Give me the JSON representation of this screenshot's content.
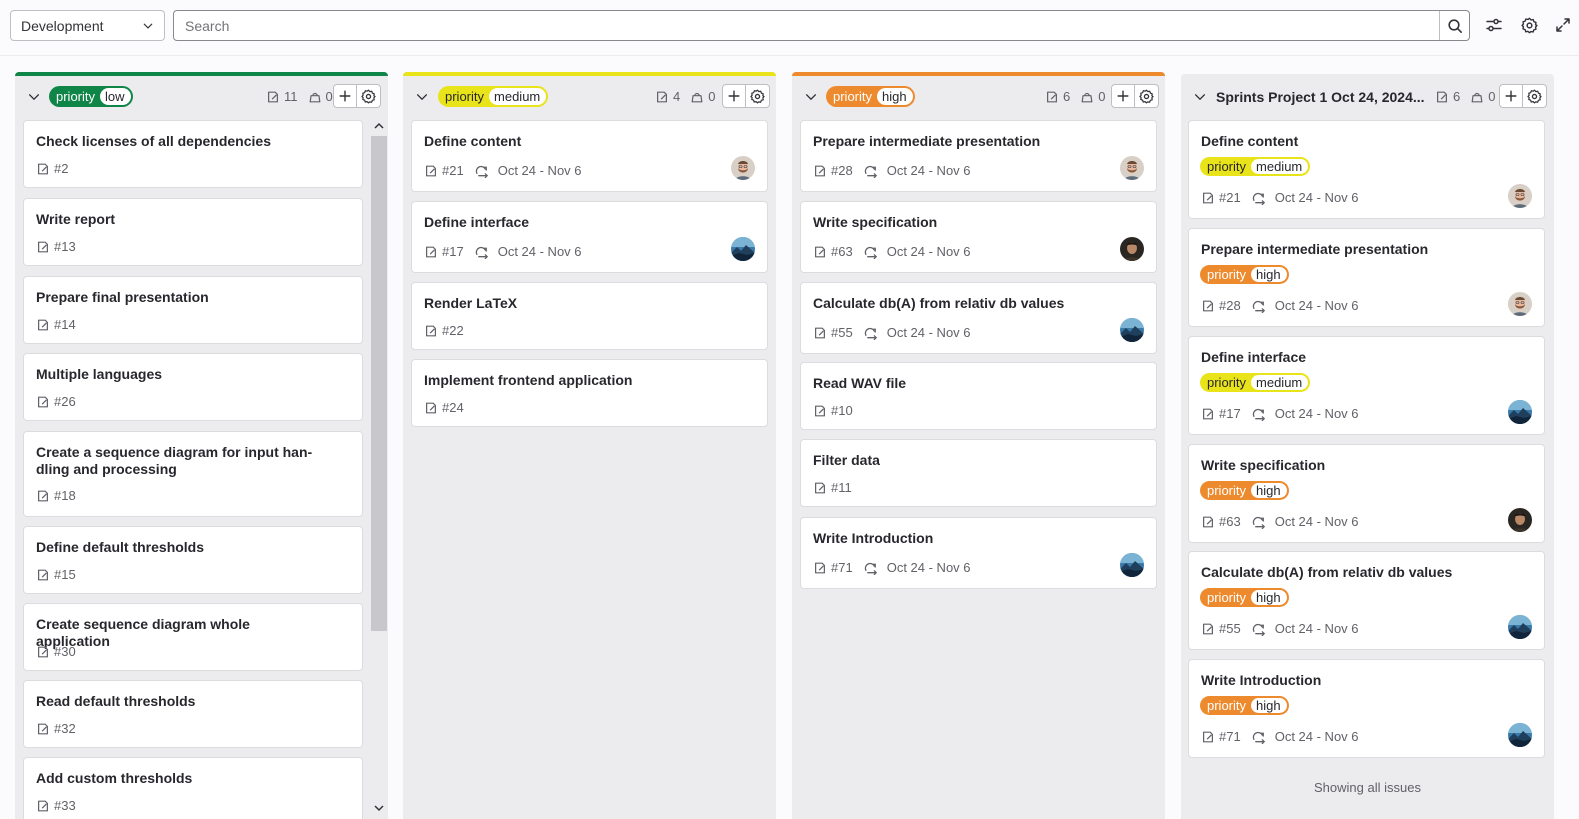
{
  "toolbar": {
    "board_select": "Development",
    "search_placeholder": "Search"
  },
  "colors": {
    "low": "#108548",
    "medium": "#e9e319",
    "high": "#ee8a2e",
    "sprint_bar": "#e4e4e8"
  },
  "lists": [
    {
      "label_key": "priority",
      "label_value": "low",
      "issues_count": "11",
      "weight": "0",
      "cards": [
        {
          "title": "Check licenses of all dependencies",
          "num": "#2"
        },
        {
          "title": "Write report",
          "num": "#13"
        },
        {
          "title": "Prepare final presentation",
          "num": "#14"
        },
        {
          "title": "Multiple languages",
          "num": "#26"
        },
        {
          "title": "Create a sequence diagram for input han-dling and processing",
          "title_line1": "Create a sequence diagram for input han-",
          "title_line2": "dling and processing",
          "num": "#18"
        },
        {
          "title": "Define default thresholds",
          "num": "#15"
        },
        {
          "title": "Create sequence diagram whole application",
          "num": "#30"
        },
        {
          "title": "Read default thresholds",
          "num": "#32"
        },
        {
          "title": "Add custom thresholds",
          "num": "#33"
        }
      ]
    },
    {
      "label_key": "priority",
      "label_value": "medium",
      "issues_count": "4",
      "weight": "0",
      "cards": [
        {
          "title": "Define content",
          "num": "#21",
          "dates": "Oct 24 - Nov 6",
          "avatar": "bearded-man-avatar"
        },
        {
          "title": "Define interface",
          "num": "#17",
          "dates": "Oct 24 - Nov 6",
          "avatar": "mountain-avatar"
        },
        {
          "title": "Render LaTeX",
          "num": "#22"
        },
        {
          "title": "Implement frontend application",
          "num": "#24"
        }
      ]
    },
    {
      "label_key": "priority",
      "label_value": "high",
      "issues_count": "6",
      "weight": "0",
      "cards": [
        {
          "title": "Prepare intermediate presentation",
          "num": "#28",
          "dates": "Oct 24 - Nov 6",
          "avatar": "bearded-man-avatar"
        },
        {
          "title": "Write specification",
          "num": "#63",
          "dates": "Oct 24 - Nov 6",
          "avatar": "dark-portrait-avatar"
        },
        {
          "title": "Calculate db(A) from relativ db values",
          "num": "#55",
          "dates": "Oct 24 - Nov 6",
          "avatar": "mountain-avatar"
        },
        {
          "title": "Read WAV file",
          "num": "#10"
        },
        {
          "title": "Filter data",
          "num": "#11"
        },
        {
          "title": "Write Introduction",
          "num": "#71",
          "dates": "Oct 24 - Nov 6",
          "avatar": "mountain-avatar"
        }
      ]
    },
    {
      "title": "Sprints Project 1 Oct 24, 2024...",
      "issues_count": "6",
      "weight": "0",
      "cards": [
        {
          "title": "Define content",
          "label_key": "priority",
          "label_value": "medium",
          "num": "#21",
          "dates": "Oct 24 - Nov 6",
          "avatar": "bearded-man-avatar"
        },
        {
          "title": "Prepare intermediate presentation",
          "label_key": "priority",
          "label_value": "high",
          "num": "#28",
          "dates": "Oct 24 - Nov 6",
          "avatar": "bearded-man-avatar"
        },
        {
          "title": "Define interface",
          "label_key": "priority",
          "label_value": "medium",
          "num": "#17",
          "dates": "Oct 24 - Nov 6",
          "avatar": "mountain-avatar"
        },
        {
          "title": "Write specification",
          "label_key": "priority",
          "label_value": "high",
          "num": "#63",
          "dates": "Oct 24 - Nov 6",
          "avatar": "dark-portrait-avatar"
        },
        {
          "title": "Calculate db(A) from relativ db values",
          "label_key": "priority",
          "label_value": "high",
          "num": "#55",
          "dates": "Oct 24 - Nov 6",
          "avatar": "mountain-avatar"
        },
        {
          "title": "Write Introduction",
          "label_key": "priority",
          "label_value": "high",
          "num": "#71",
          "dates": "Oct 24 - Nov 6",
          "avatar": "mountain-avatar"
        }
      ],
      "footer": "Showing all issues"
    }
  ]
}
